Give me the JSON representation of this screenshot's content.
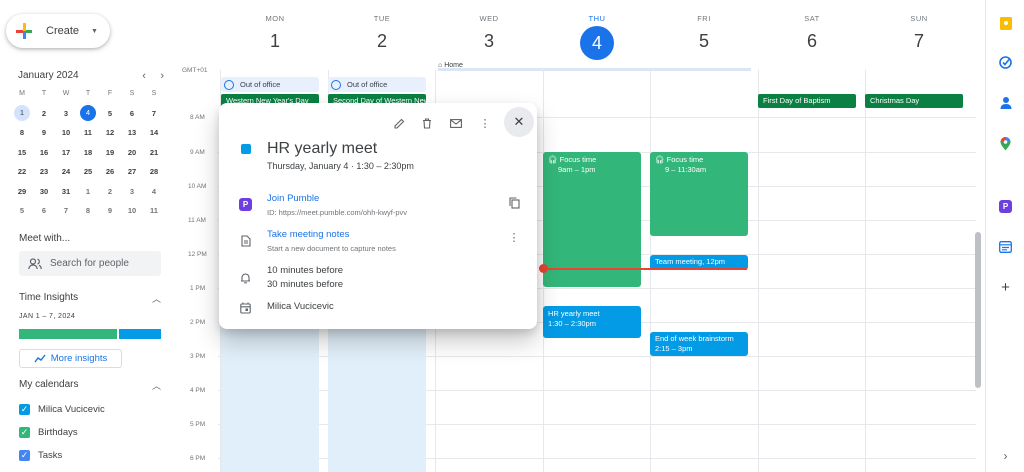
{
  "sidebar": {
    "create_label": "Create",
    "mini_cal": {
      "month": "January 2024",
      "dow": [
        "M",
        "T",
        "W",
        "T",
        "F",
        "S",
        "S"
      ],
      "weeks": [
        [
          "1",
          "2",
          "3",
          "4",
          "5",
          "6",
          "7"
        ],
        [
          "8",
          "9",
          "10",
          "11",
          "12",
          "13",
          "14"
        ],
        [
          "15",
          "16",
          "17",
          "18",
          "19",
          "20",
          "21"
        ],
        [
          "22",
          "23",
          "24",
          "25",
          "26",
          "27",
          "28"
        ],
        [
          "29",
          "30",
          "31",
          "1",
          "2",
          "3",
          "4"
        ],
        [
          "5",
          "6",
          "7",
          "8",
          "9",
          "10",
          "11"
        ]
      ]
    },
    "meet_with": "Meet with...",
    "search_people": "Search for people",
    "time_insights": {
      "title": "Time Insights",
      "range": "JAN 1 – 7, 2024",
      "more": "More insights"
    },
    "my_calendars": {
      "title": "My calendars",
      "items": [
        {
          "label": "Milica Vucicevic",
          "color": "#039be5"
        },
        {
          "label": "Birthdays",
          "color": "#33b679"
        },
        {
          "label": "Tasks",
          "color": "#4285f4"
        }
      ]
    }
  },
  "calendar": {
    "timezone": "GMT+01",
    "days": [
      {
        "dow": "MON",
        "num": "1"
      },
      {
        "dow": "TUE",
        "num": "2"
      },
      {
        "dow": "WED",
        "num": "3"
      },
      {
        "dow": "THU",
        "num": "4"
      },
      {
        "dow": "FRI",
        "num": "5"
      },
      {
        "dow": "SAT",
        "num": "6"
      },
      {
        "dow": "SUN",
        "num": "7"
      }
    ],
    "hours": [
      "8 AM",
      "9 AM",
      "10 AM",
      "11 AM",
      "12 PM",
      "1 PM",
      "2 PM",
      "3 PM",
      "4 PM",
      "5 PM",
      "6 PM"
    ],
    "home_label": "Home",
    "out_of_office": "Out of office",
    "allday": [
      {
        "title": "Western New Year's Day"
      },
      {
        "title": "Second Day of Western New Year"
      },
      {
        "title": "First Day of Baptism"
      },
      {
        "title": "Christmas Day"
      }
    ],
    "events": [
      {
        "title": "Focus time",
        "time": "9am – 1pm"
      },
      {
        "title": "Focus time",
        "time": "9 – 11:30am"
      },
      {
        "title": "Team meeting,",
        "time": "12pm"
      },
      {
        "title": "HR yearly meet",
        "time": "1:30 – 2:30pm"
      },
      {
        "title": "End of week brainstorm",
        "time": "2:15 – 3pm"
      }
    ]
  },
  "popup": {
    "title": "HR yearly meet",
    "when": "Thursday, January 4  ·  1:30 – 2:30pm",
    "join": "Join Pumble",
    "join_id": "ID: https://meet.pumble.com/ohh-kwyf-pvv",
    "notes": "Take meeting notes",
    "notes_sub": "Start a new document to capture notes",
    "reminder1": "10 minutes before",
    "reminder2": "30 minutes before",
    "organizer": "Milica Vucicevic"
  },
  "colors": {
    "accent": "#1a73e8",
    "event_blue": "#039be5",
    "event_green": "#33b679",
    "holiday_green": "#0b8043",
    "now_red": "#ea4335"
  }
}
